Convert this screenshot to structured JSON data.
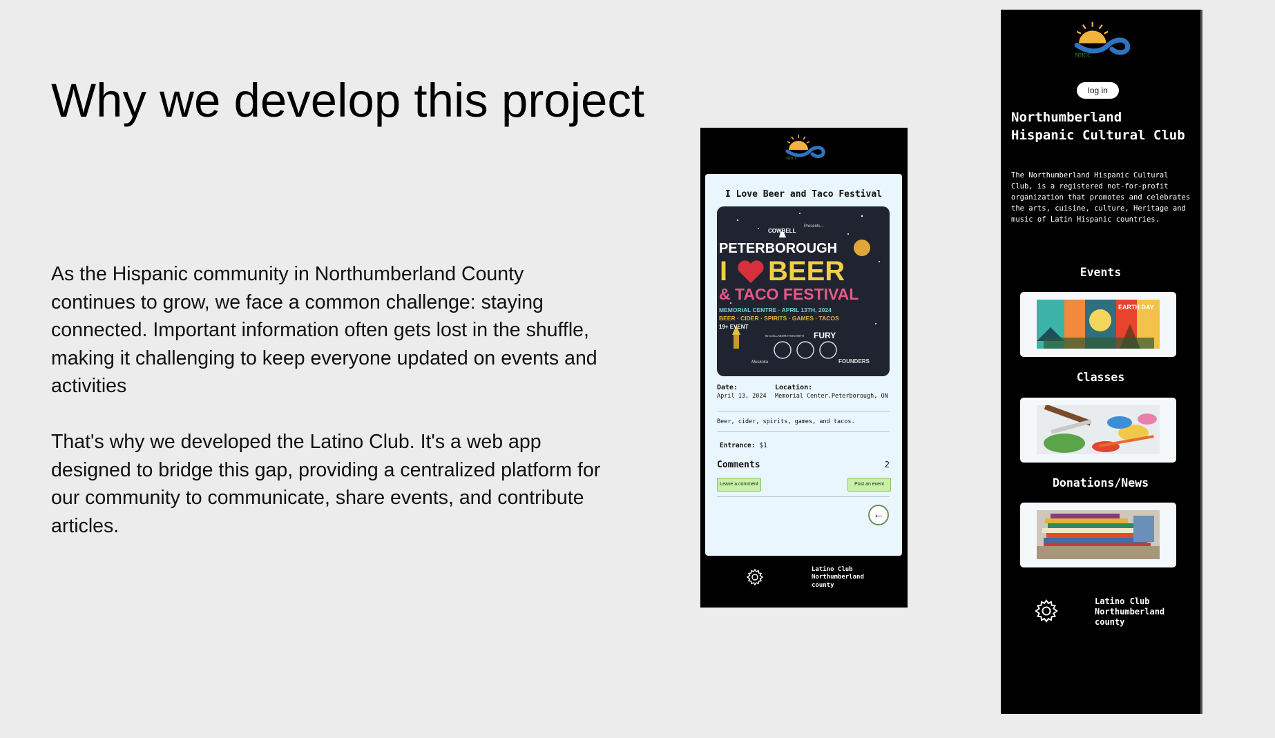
{
  "slide": {
    "title": "Why we develop this project",
    "paragraph1": "As the Hispanic community in Northumberland County continues to grow, we face a common challenge: staying connected. Important information often gets lost in the shuffle, making it challenging to keep everyone updated on events and activities",
    "paragraph2": "That's why we developed the Latino Club. It's a web app designed to bridge this gap, providing a centralized platform for our community to communicate, share events, and contribute articles."
  },
  "event_screen": {
    "logo_text": "NHCC",
    "event_title": "I Love Beer and Taco Festival",
    "poster": {
      "brand": "COWBELL",
      "presents": "Presents...",
      "line1": "PETERBOROUGH",
      "line2a": "I",
      "line2b": "BEER",
      "line3": "& TACO FESTIVAL",
      "line4": "MEMORIAL CENTRE · APRIL 13TH, 2024",
      "line5": "BEER · CIDER · SPIRITS · GAMES · TACOS",
      "line6": "19+ EVENT",
      "collab": "IN COLLABORATION WITH",
      "fury": "FURY",
      "founders": "FOUNDERS",
      "sponsor1": "Muskoka"
    },
    "date_label": "Date:",
    "date_value": "April 13, 2024",
    "location_label": "Location:",
    "location_value": "Memorial Center.Peterborough, ON",
    "description": "Beer, cider, spirits, games, and tacos.",
    "entrance_label": "Entrance:",
    "entrance_value": "$1",
    "comments_label": "Comments",
    "comments_count": "2",
    "leave_comment_label": "Leave a comment",
    "post_event_label": "Post an event",
    "back_icon": "←",
    "footer_text_1": "Latino Club",
    "footer_text_2": "Northumberland",
    "footer_text_3": "county"
  },
  "home_screen": {
    "logo_text": "NHCC",
    "login_label": "log in",
    "club_title": "Northumberland Hispanic Cultural Club",
    "club_description": "The Northumberland Hispanic Cultural Club, is a registered not-for-profit organization that promotes and celebrates the arts, cuisine, culture, Heritage and music of Latin Hispanic countries.",
    "sections": [
      {
        "label": "Events",
        "image_text": "EARTH DAY"
      },
      {
        "label": "Classes"
      },
      {
        "label": "Donations/News"
      }
    ],
    "footer_text_1": "Latino Club",
    "footer_text_2": "Northumberland",
    "footer_text_3": "county"
  },
  "colors": {
    "background": "#ececec",
    "phone_frame": "#000000",
    "card": "#eaf6fd",
    "accent_green": "#c8f0a6",
    "sun": "#f2b33a",
    "wave": "#2e74c0"
  },
  "icons": {
    "settings": "gear-icon",
    "back": "arrow-left-icon",
    "logo": "sun-wave-logo"
  }
}
